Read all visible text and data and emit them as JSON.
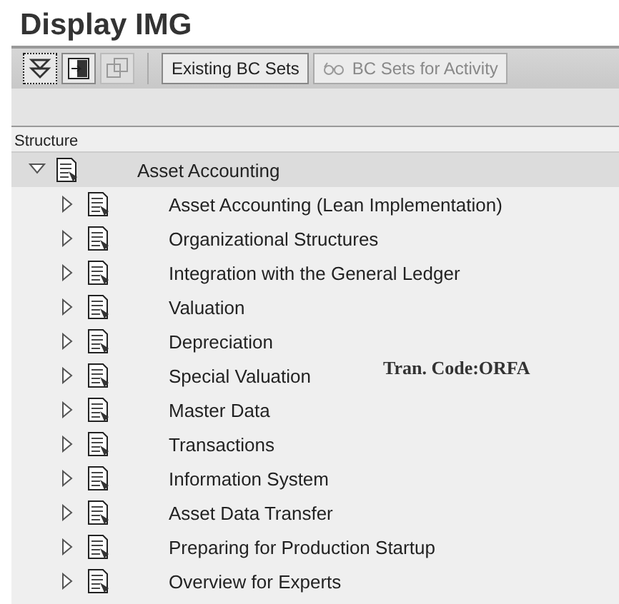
{
  "window": {
    "title": "Display IMG"
  },
  "toolbar": {
    "icon_buttons": [
      {
        "kind": "expand-all",
        "disabled": false,
        "focused": true
      },
      {
        "kind": "doc",
        "disabled": false,
        "focused": false
      },
      {
        "kind": "copy",
        "disabled": true,
        "focused": false
      }
    ],
    "buttons": [
      {
        "label": "Existing BC Sets",
        "disabled": false,
        "kind": "plain"
      },
      {
        "label": "BC Sets for Activity",
        "disabled": true,
        "kind": "glasses"
      }
    ]
  },
  "tree": {
    "header": "Structure",
    "items": [
      {
        "label": "Asset Accounting",
        "expanded": true,
        "selected": true,
        "children": [
          {
            "label": "Asset Accounting (Lean Implementation)",
            "expanded": false,
            "selected": false
          },
          {
            "label": "Organizational Structures",
            "expanded": false,
            "selected": false
          },
          {
            "label": "Integration with the General Ledger",
            "expanded": false,
            "selected": false
          },
          {
            "label": "Valuation",
            "expanded": false,
            "selected": false
          },
          {
            "label": "Depreciation",
            "expanded": false,
            "selected": false
          },
          {
            "label": "Special Valuation",
            "expanded": false,
            "selected": false
          },
          {
            "label": "Master Data",
            "expanded": false,
            "selected": false
          },
          {
            "label": "Transactions",
            "expanded": false,
            "selected": false
          },
          {
            "label": "Information System",
            "expanded": false,
            "selected": false
          },
          {
            "label": "Asset Data Transfer",
            "expanded": false,
            "selected": false
          },
          {
            "label": "Preparing for Production Startup",
            "expanded": false,
            "selected": false
          },
          {
            "label": "Overview for Experts",
            "expanded": false,
            "selected": false
          }
        ]
      }
    ]
  },
  "annotation": "Tran. Code:ORFA"
}
